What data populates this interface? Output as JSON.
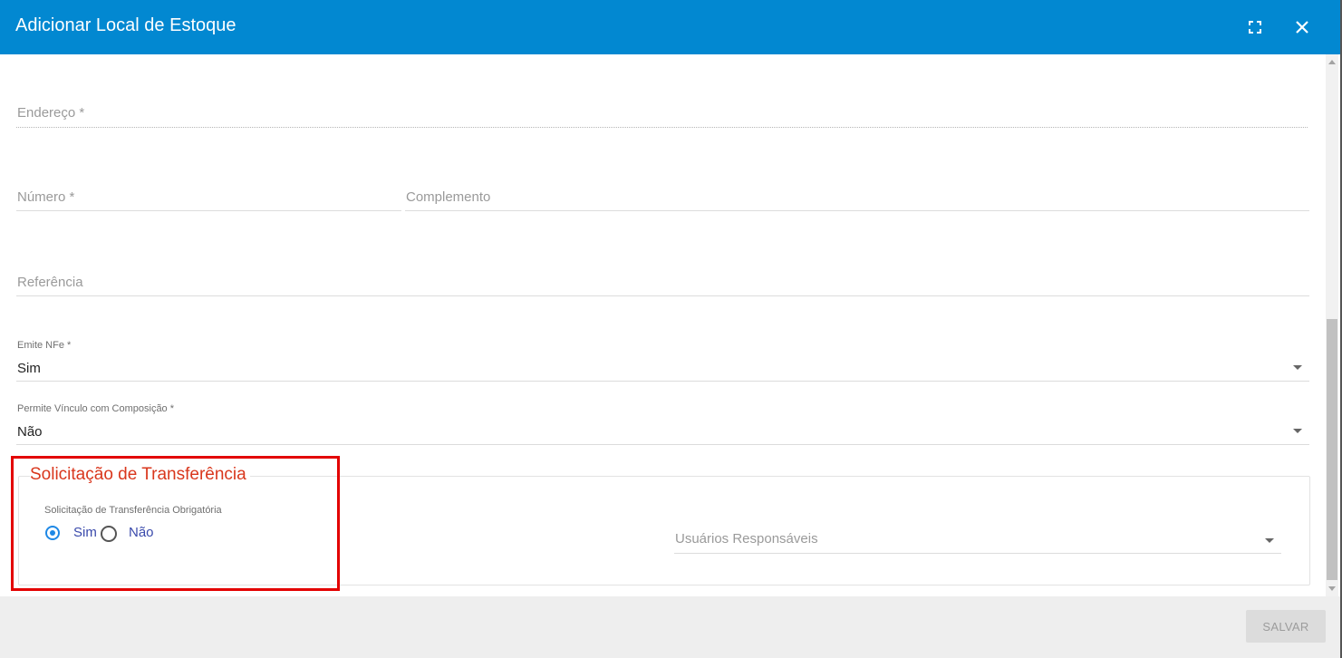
{
  "dialog": {
    "title": "Adicionar Local de Estoque",
    "maximize_icon": "fullscreen-icon",
    "close_icon": "close-icon"
  },
  "form": {
    "endereco": {
      "placeholder": "Endereço *"
    },
    "numero": {
      "placeholder": "Número *"
    },
    "complemento": {
      "placeholder": "Complemento"
    },
    "referencia": {
      "placeholder": "Referência"
    },
    "emite_nfe": {
      "label": "Emite NFe *",
      "value": "Sim"
    },
    "permite_vinculo": {
      "label": "Permite Vínculo com Composição *",
      "value": "Não"
    }
  },
  "transferencia": {
    "section_title": "Solicitação de Transferência",
    "obrigatoria_label": "Solicitação de Transferência Obrigatória",
    "options": [
      "Sim",
      "Não"
    ],
    "selected": "Sim",
    "usuarios_placeholder": "Usuários Responsáveis"
  },
  "footer": {
    "save_label": "SALVAR"
  },
  "colors": {
    "header": "#0288d1",
    "section_title": "#d9371d",
    "radio_selected": "#1e88e5",
    "highlight_box": "#e30000"
  }
}
